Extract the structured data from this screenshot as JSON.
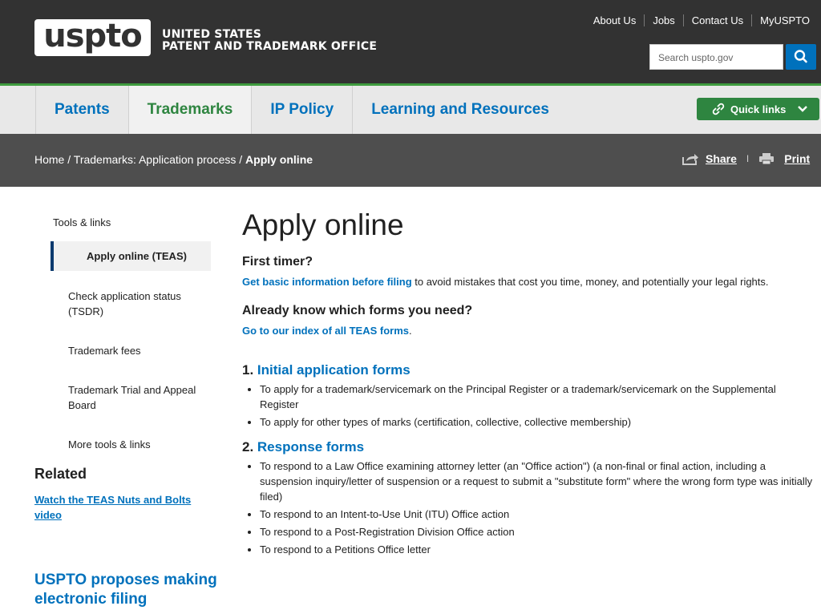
{
  "header": {
    "logo_text": "uspto",
    "agency_line1": "UNITED STATES",
    "agency_line2": "PATENT AND TRADEMARK OFFICE",
    "top_links": [
      "About Us",
      "Jobs",
      "Contact Us",
      "MyUSPTO"
    ],
    "search_placeholder": "Search uspto.gov"
  },
  "nav": {
    "items": [
      "Patents",
      "Trademarks",
      "IP Policy",
      "Learning and Resources"
    ],
    "active": "Trademarks",
    "quick_links": "Quick links"
  },
  "breadcrumb": {
    "home": "Home",
    "sep1": " / ",
    "section": "Trademarks: Application process",
    "sep2": " / ",
    "current": "Apply online",
    "share": "Share",
    "divider": "I",
    "print": "Print"
  },
  "sidebar": {
    "heading": "Tools & links",
    "items": [
      "Apply online (TEAS)",
      "Check application status (TSDR)",
      "Trademark fees",
      "Trademark Trial and Appeal Board",
      "More tools & links"
    ],
    "related_heading": "Related",
    "related_link": "Watch the TEAS Nuts and Bolts video",
    "promo_title": "USPTO proposes making electronic filing"
  },
  "main": {
    "title": "Apply online",
    "first_timer_heading": "First timer?",
    "first_timer_link": "Get basic information before filing",
    "first_timer_text": " to avoid mistakes that cost you time, money, and potentially your legal rights.",
    "know_forms_heading": "Already know which forms you need?",
    "index_link": "Go to our index of all TEAS forms",
    "index_period": ".",
    "section1_number": "1. ",
    "section1_title": "Initial application forms",
    "section1_items": [
      "To apply for a trademark/servicemark on the Principal Register or a trademark/servicemark on the Supplemental Register",
      "To apply for other types of marks (certification, collective, collective membership)"
    ],
    "section2_number": "2. ",
    "section2_title": "Response forms",
    "section2_items": [
      "To respond to a Law Office examining attorney letter (an \"Office action\") (a non-final or final action, including a suspension inquiry/letter of suspension or a request to submit a \"substitute form\" where the wrong form type was initially filed)",
      "To respond to an Intent-to-Use Unit (ITU) Office action",
      "To respond to a Post-Registration Division Office action",
      "To respond to a Petitions Office letter"
    ]
  },
  "colors": {
    "header_bg": "#323232",
    "nav_bg": "#e8e8e8",
    "accent_blue": "#0071bc",
    "accent_green": "#2e8540",
    "crumb_bg": "#4e4e4e"
  }
}
